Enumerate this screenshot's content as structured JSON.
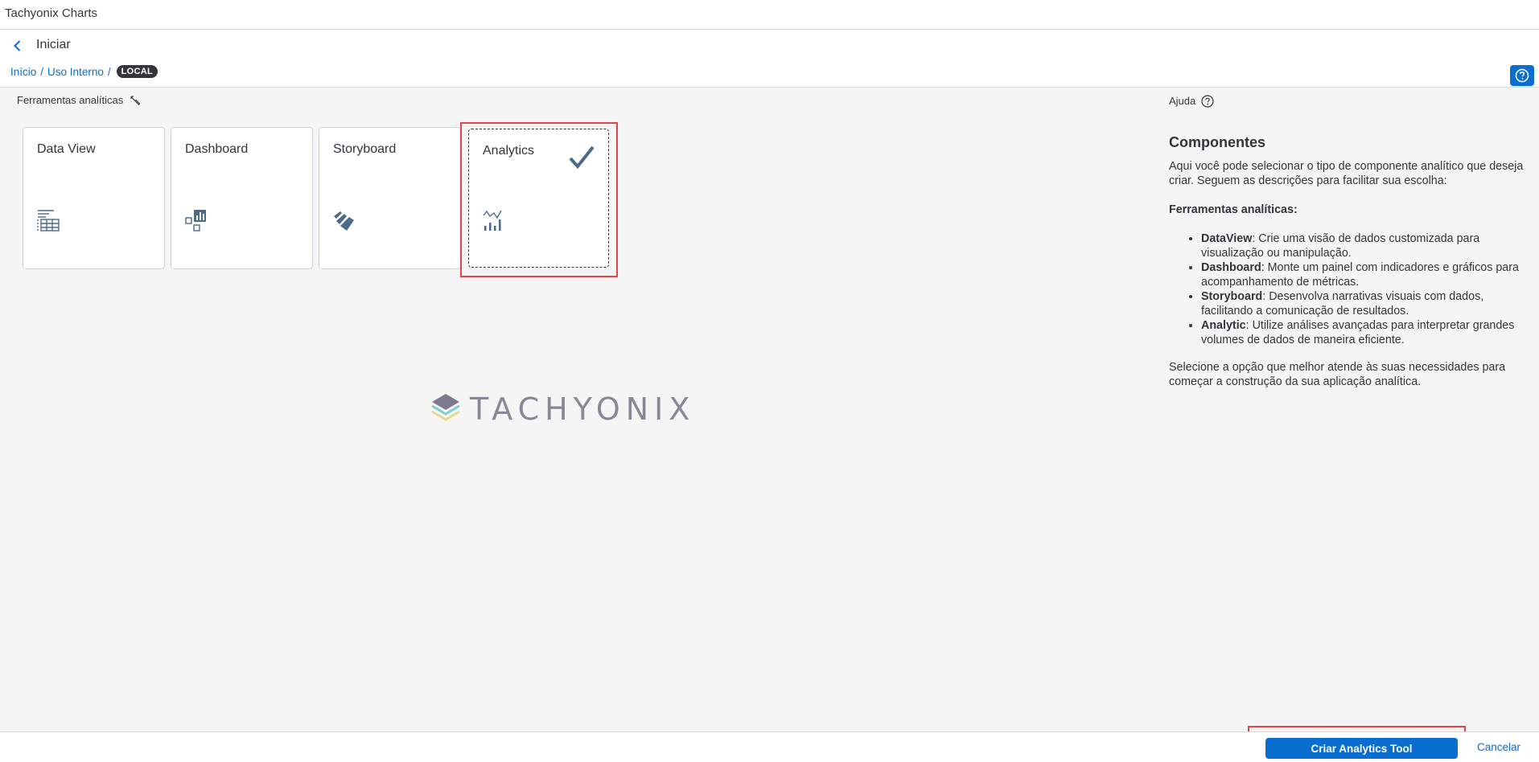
{
  "app": {
    "title": "Tachyonix Charts"
  },
  "header": {
    "page_title": "Iniciar",
    "breadcrumb": {
      "home": "Início",
      "section": "Uso Interno",
      "separator": "/",
      "badge": "LOCAL"
    }
  },
  "tools": {
    "section_label": "Ferramentas analíticas",
    "tiles": [
      {
        "label": "Data View",
        "icon": "table-list-icon",
        "selected": false
      },
      {
        "label": "Dashboard",
        "icon": "dashboard-icon",
        "selected": false
      },
      {
        "label": "Storyboard",
        "icon": "storyboard-icon",
        "selected": false
      },
      {
        "label": "Analytics",
        "icon": "line-bar-chart-icon",
        "selected": true
      }
    ]
  },
  "logo": {
    "wordmark": "TACHYONIX"
  },
  "help": {
    "label": "Ajuda",
    "title": "Componentes",
    "intro": "Aqui você pode selecionar o tipo de componente analítico que deseja criar. Seguem as descrições para facilitar sua escolha:",
    "subtitle": "Ferramentas analíticas:",
    "items": [
      {
        "term": "DataView",
        "desc": ": Crie uma visão de dados customizada para visualização ou manipulação."
      },
      {
        "term": "Dashboard",
        "desc": ": Monte um painel com indicadores e gráficos para acompanhamento de métricas."
      },
      {
        "term": "Storyboard",
        "desc": ": Desenvolva narrativas visuais com dados, facilitando a comunicação de resultados."
      },
      {
        "term": "Analytic",
        "desc": ": Utilize análises avançadas para interpretar grandes volumes de dados de maneira eficiente."
      }
    ],
    "closing": "Selecione a opção que melhor atende às suas necessidades para começar a construção da sua aplicação analítica."
  },
  "footer": {
    "primary_label": "Criar Analytics Tool",
    "cancel_label": "Cancelar"
  },
  "colors": {
    "accent": "#0a6ed1",
    "highlight": "#e3454a",
    "icon": "#4a6a8a"
  }
}
